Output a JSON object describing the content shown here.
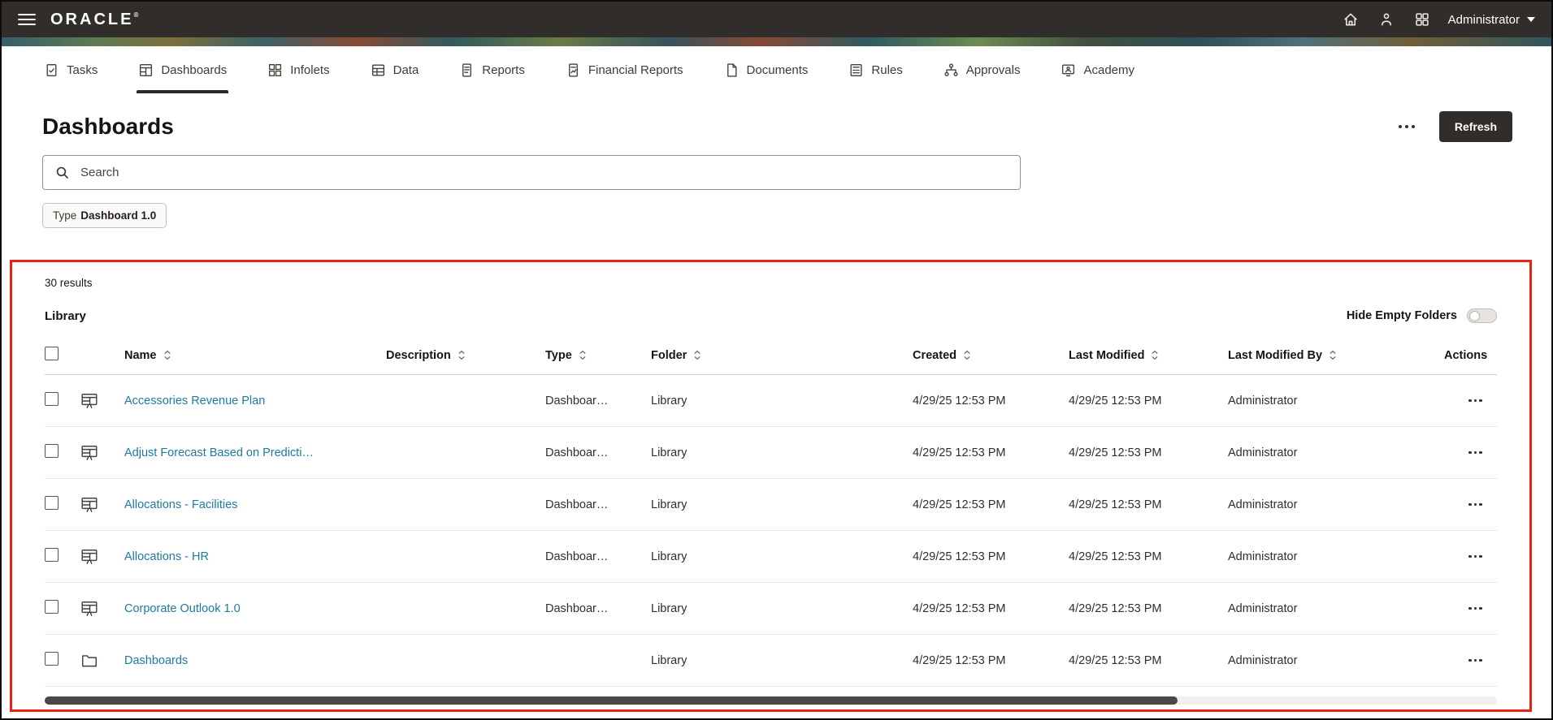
{
  "topbar": {
    "brand": "ORACLE",
    "registered": "®",
    "user": "Administrator"
  },
  "tabs": [
    {
      "label": "Tasks",
      "icon": "tasks",
      "active": false
    },
    {
      "label": "Dashboards",
      "icon": "dashboards",
      "active": true
    },
    {
      "label": "Infolets",
      "icon": "infolets",
      "active": false
    },
    {
      "label": "Data",
      "icon": "data",
      "active": false
    },
    {
      "label": "Reports",
      "icon": "reports",
      "active": false
    },
    {
      "label": "Financial Reports",
      "icon": "financial-reports",
      "active": false
    },
    {
      "label": "Documents",
      "icon": "documents",
      "active": false
    },
    {
      "label": "Rules",
      "icon": "rules",
      "active": false
    },
    {
      "label": "Approvals",
      "icon": "approvals",
      "active": false
    },
    {
      "label": "Academy",
      "icon": "academy",
      "active": false
    }
  ],
  "page": {
    "title": "Dashboards",
    "refresh_label": "Refresh"
  },
  "search": {
    "placeholder": "Search"
  },
  "filter_chip": {
    "label": "Type",
    "value": "Dashboard 1.0"
  },
  "results": {
    "count_text": "30 results",
    "section_title": "Library",
    "hide_empty_label": "Hide Empty Folders",
    "hide_empty_enabled": false
  },
  "table": {
    "columns": [
      {
        "label": "Name",
        "sortable": true
      },
      {
        "label": "Description",
        "sortable": true
      },
      {
        "label": "Type",
        "sortable": true
      },
      {
        "label": "Folder",
        "sortable": true
      },
      {
        "label": "Created",
        "sortable": true
      },
      {
        "label": "Last Modified",
        "sortable": true
      },
      {
        "label": "Last Modified By",
        "sortable": true
      },
      {
        "label": "Actions",
        "sortable": false
      }
    ],
    "rows": [
      {
        "icon": "dashboard",
        "name": "Accessories Revenue Plan",
        "description": "",
        "type": "Dashboar…",
        "folder": "Library",
        "created": "4/29/25 12:53 PM",
        "last_modified": "4/29/25 12:53 PM",
        "last_modified_by": "Administrator"
      },
      {
        "icon": "dashboard",
        "name": "Adjust Forecast Based on Predicti…",
        "description": "",
        "type": "Dashboar…",
        "folder": "Library",
        "created": "4/29/25 12:53 PM",
        "last_modified": "4/29/25 12:53 PM",
        "last_modified_by": "Administrator"
      },
      {
        "icon": "dashboard",
        "name": "Allocations - Facilities",
        "description": "",
        "type": "Dashboar…",
        "folder": "Library",
        "created": "4/29/25 12:53 PM",
        "last_modified": "4/29/25 12:53 PM",
        "last_modified_by": "Administrator"
      },
      {
        "icon": "dashboard",
        "name": "Allocations - HR",
        "description": "",
        "type": "Dashboar…",
        "folder": "Library",
        "created": "4/29/25 12:53 PM",
        "last_modified": "4/29/25 12:53 PM",
        "last_modified_by": "Administrator"
      },
      {
        "icon": "dashboard",
        "name": "Corporate Outlook 1.0",
        "description": "",
        "type": "Dashboar…",
        "folder": "Library",
        "created": "4/29/25 12:53 PM",
        "last_modified": "4/29/25 12:53 PM",
        "last_modified_by": "Administrator"
      },
      {
        "icon": "folder",
        "name": "Dashboards",
        "description": "",
        "type": "",
        "folder": "Library",
        "created": "4/29/25 12:53 PM",
        "last_modified": "4/29/25 12:53 PM",
        "last_modified_by": "Administrator"
      }
    ]
  },
  "colors": {
    "topbar_bg": "#312d2a",
    "link": "#1d7b9c",
    "annotation_red": "#ea2213",
    "primary_button": "#312d2a"
  }
}
